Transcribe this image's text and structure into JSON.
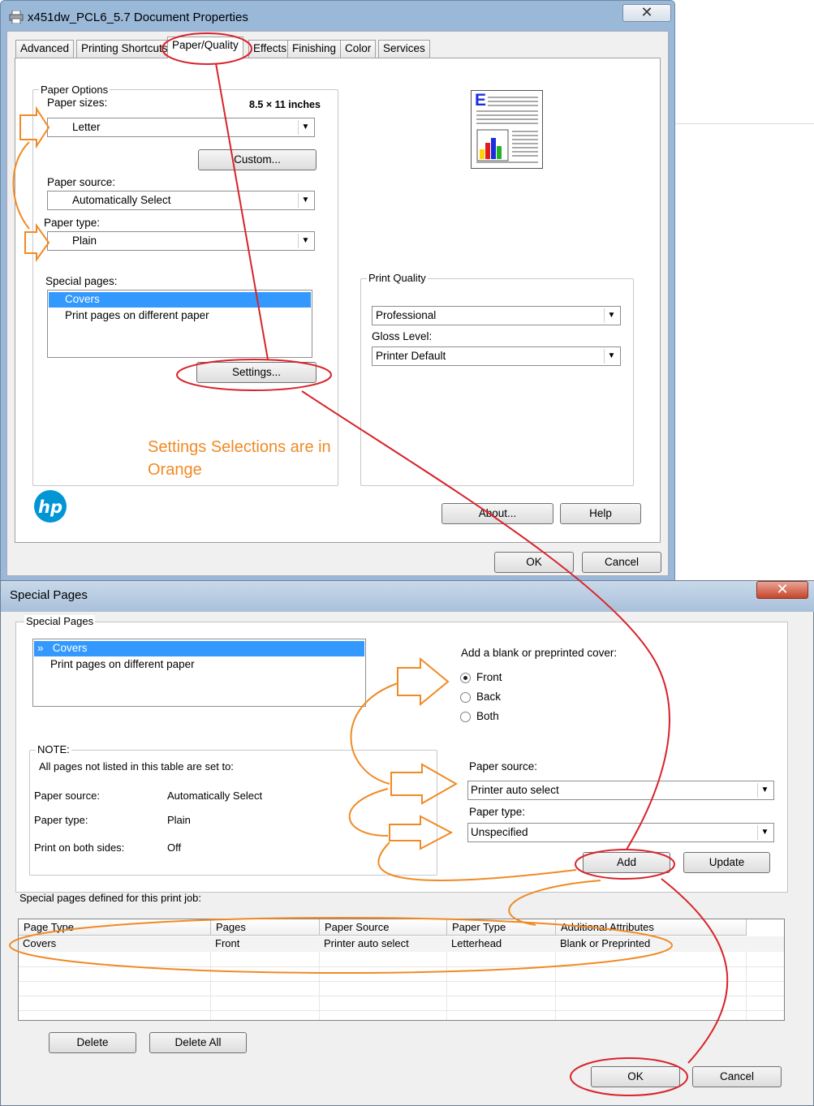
{
  "window1": {
    "title": "x451dw_PCL6_5.7 Document Properties",
    "tabs": [
      {
        "label": "Advanced"
      },
      {
        "label": "Printing Shortcuts"
      },
      {
        "label": "Paper/Quality"
      },
      {
        "label": "Effects"
      },
      {
        "label": "Finishing"
      },
      {
        "label": "Color"
      },
      {
        "label": "Services"
      }
    ],
    "active_tab": "Paper/Quality",
    "paper_options": {
      "group_label": "Paper Options",
      "sizes_label": "Paper sizes:",
      "size_dimensions": "8.5 × 11 inches",
      "size_value": "Letter",
      "custom_button": "Custom...",
      "source_label": "Paper source:",
      "source_value": "Automatically Select",
      "type_label": "Paper type:",
      "type_value": "Plain",
      "special_pages_label": "Special pages:",
      "special_pages": [
        "Covers",
        "Print pages on different paper"
      ],
      "settings_button": "Settings..."
    },
    "print_quality": {
      "group_label": "Print Quality",
      "quality_value": "Professional",
      "gloss_label": "Gloss Level:",
      "gloss_value": "Printer Default"
    },
    "annotation_text": "Settings Selections are in Orange",
    "buttons": {
      "about": "About...",
      "help": "Help",
      "ok": "OK",
      "cancel": "Cancel"
    },
    "preview_letter": "E"
  },
  "window2": {
    "title": "Special Pages",
    "group_label": "Special Pages",
    "list": [
      "Covers",
      "Print pages on different paper"
    ],
    "list_marker": "»",
    "cover_label": "Add a blank or preprinted cover:",
    "cover_options": [
      "Front",
      "Back",
      "Both"
    ],
    "cover_selected": "Front",
    "note": {
      "label": "NOTE:",
      "text": "All pages not listed in this table are set to:",
      "rows": [
        {
          "key": "Paper source:",
          "value": "Automatically Select"
        },
        {
          "key": "Paper type:",
          "value": "Plain"
        },
        {
          "key": "Print on both sides:",
          "value": "Off"
        }
      ]
    },
    "paper_source_label": "Paper source:",
    "paper_source_value": "Printer auto select",
    "paper_type_label": "Paper type:",
    "paper_type_value": "Unspecified",
    "add_button": "Add",
    "update_button": "Update",
    "defined_label": "Special pages defined for this print job:",
    "table": {
      "headers": [
        "Page Type",
        "Pages",
        "Paper Source",
        "Paper Type",
        "Additional Attributes"
      ],
      "rows": [
        [
          "Covers",
          "Front",
          "Printer auto select",
          "Letterhead",
          "Blank or Preprinted"
        ]
      ]
    },
    "delete_button": "Delete",
    "delete_all_button": "Delete All",
    "ok_button": "OK",
    "cancel_button": "Cancel"
  },
  "colors": {
    "accent_orange": "#f08a24",
    "annotation_red": "#d8232a",
    "selection_blue": "#3399ff",
    "hp_blue": "#0096d6"
  }
}
